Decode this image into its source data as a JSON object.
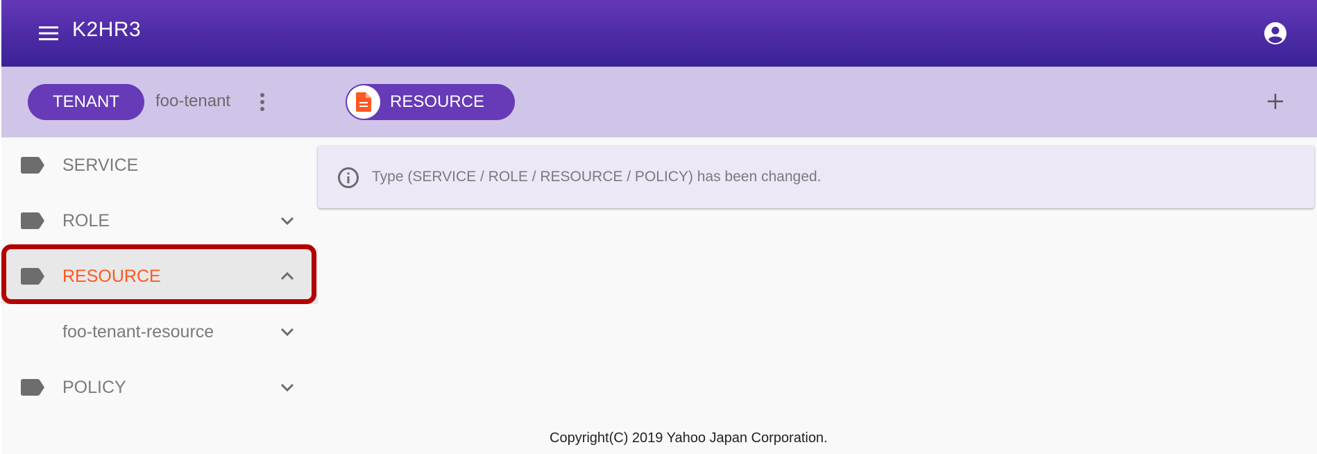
{
  "app": {
    "title": "K2HR3"
  },
  "toolbar": {
    "tenant_chip_label": "TENANT",
    "tenant_name": "foo-tenant",
    "resource_chip_label": "RESOURCE"
  },
  "sidebar": {
    "items": [
      {
        "label": "SERVICE",
        "icon": "label-icon",
        "expandable": false
      },
      {
        "label": "ROLE",
        "icon": "label-icon",
        "expandable": true,
        "expanded": false
      },
      {
        "label": "RESOURCE",
        "icon": "label-icon",
        "expandable": true,
        "expanded": true,
        "selected": true
      },
      {
        "label": "foo-tenant-resource",
        "expandable": true,
        "expanded": false,
        "child": true
      },
      {
        "label": "POLICY",
        "icon": "label-icon",
        "expandable": true,
        "expanded": false
      }
    ]
  },
  "message": {
    "text": "Type (SERVICE / ROLE / RESOURCE / POLICY) has been changed."
  },
  "footer": {
    "copyright": "Copyright(C) 2019 Yahoo Japan Corporation."
  },
  "colors": {
    "appbar": "#4a2aa3",
    "toolbar": "#d1c4e9",
    "chip": "#673ab7",
    "selected_text": "#ff5722",
    "highlight_border": "#b30000",
    "message_bg": "#ede7f6"
  }
}
